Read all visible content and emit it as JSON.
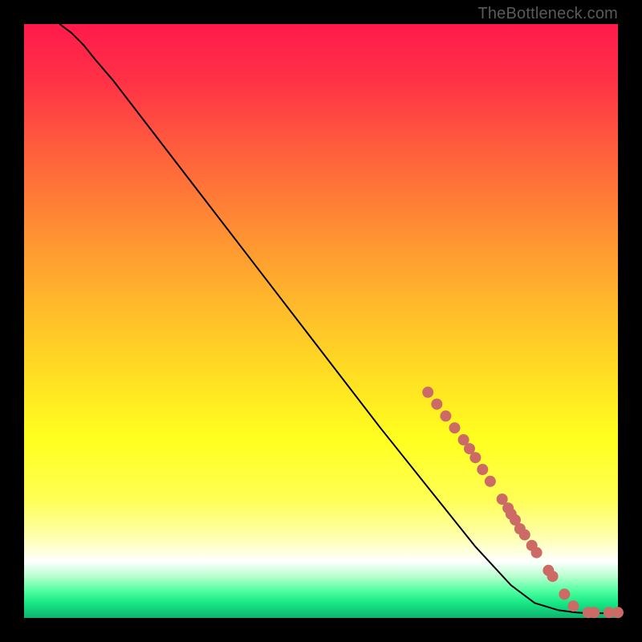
{
  "watermark": "TheBottleneck.com",
  "chart_data": {
    "type": "line",
    "title": "",
    "xlabel": "",
    "ylabel": "",
    "xlim": [
      0,
      100
    ],
    "ylim": [
      0,
      100
    ],
    "grid": false,
    "legend": false,
    "gradient_stops": [
      {
        "pos": 0.0,
        "color": "#ff1a4b"
      },
      {
        "pos": 0.1,
        "color": "#ff3346"
      },
      {
        "pos": 0.2,
        "color": "#ff5a3e"
      },
      {
        "pos": 0.3,
        "color": "#ff7e36"
      },
      {
        "pos": 0.4,
        "color": "#ffa130"
      },
      {
        "pos": 0.5,
        "color": "#ffc229"
      },
      {
        "pos": 0.6,
        "color": "#ffe122"
      },
      {
        "pos": 0.7,
        "color": "#ffff1f"
      },
      {
        "pos": 0.8,
        "color": "#ffff55"
      },
      {
        "pos": 0.86,
        "color": "#ffffa8"
      },
      {
        "pos": 0.905,
        "color": "#ffffff"
      },
      {
        "pos": 0.93,
        "color": "#b7ffce"
      },
      {
        "pos": 0.955,
        "color": "#4dffa0"
      },
      {
        "pos": 0.975,
        "color": "#17e884"
      },
      {
        "pos": 1.0,
        "color": "#0db36f"
      }
    ],
    "series": [
      {
        "name": "curve",
        "stroke": "#000000",
        "x": [
          6,
          8,
          10,
          12,
          15,
          20,
          30,
          40,
          50,
          60,
          68,
          76,
          82,
          86,
          90,
          93,
          95,
          98,
          100
        ],
        "y": [
          100,
          98.5,
          96.5,
          94,
          90.5,
          84,
          71,
          58,
          45,
          32,
          22,
          12,
          5.5,
          2.5,
          1.3,
          0.9,
          0.8,
          0.8,
          0.8
        ]
      }
    ],
    "markers": {
      "color": "#cc6a66",
      "radius_px": 7,
      "points": [
        {
          "x": 68.0,
          "y": 38.0
        },
        {
          "x": 69.5,
          "y": 36.0
        },
        {
          "x": 71.0,
          "y": 34.0
        },
        {
          "x": 72.5,
          "y": 32.0
        },
        {
          "x": 74.0,
          "y": 30.0
        },
        {
          "x": 75.0,
          "y": 28.5
        },
        {
          "x": 76.0,
          "y": 27.0
        },
        {
          "x": 77.2,
          "y": 25.0
        },
        {
          "x": 78.5,
          "y": 23.0
        },
        {
          "x": 80.5,
          "y": 20.0
        },
        {
          "x": 81.5,
          "y": 18.5
        },
        {
          "x": 82.0,
          "y": 17.5
        },
        {
          "x": 82.7,
          "y": 16.5
        },
        {
          "x": 83.5,
          "y": 15.0
        },
        {
          "x": 84.3,
          "y": 14.0
        },
        {
          "x": 85.5,
          "y": 12.2
        },
        {
          "x": 86.3,
          "y": 11.0
        },
        {
          "x": 88.3,
          "y": 8.0
        },
        {
          "x": 89.0,
          "y": 7.0
        },
        {
          "x": 91.0,
          "y": 4.0
        },
        {
          "x": 92.5,
          "y": 2.0
        },
        {
          "x": 95.0,
          "y": 0.9
        },
        {
          "x": 96.0,
          "y": 0.9
        },
        {
          "x": 98.5,
          "y": 0.9
        },
        {
          "x": 100.0,
          "y": 0.9
        }
      ]
    }
  }
}
